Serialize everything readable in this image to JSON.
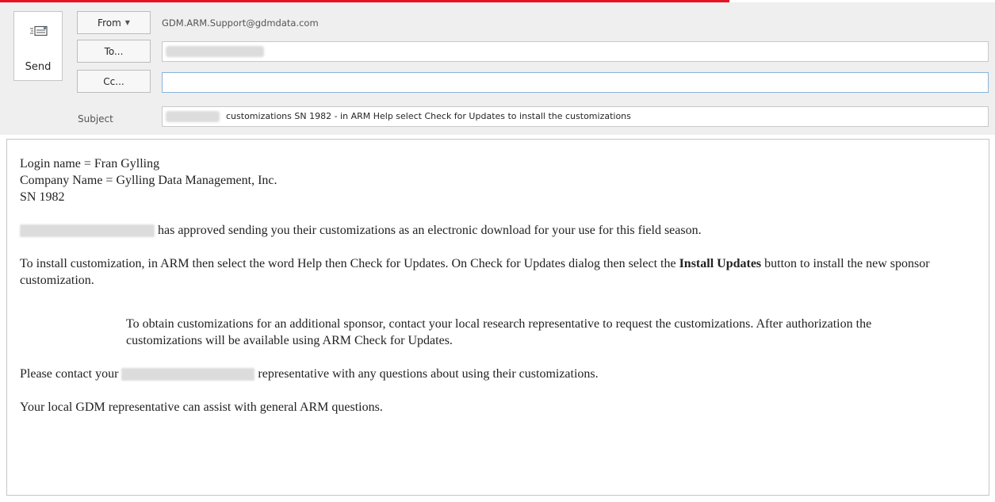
{
  "compose": {
    "send_label": "Send",
    "from_button": "From",
    "from_value": "GDM.ARM.Support@gdmdata.com",
    "to_button": "To...",
    "cc_button": "Cc...",
    "subject_label": "Subject",
    "subject_value": "customizations SN 1982 - in ARM Help select Check for Updates to install the customizations"
  },
  "message": {
    "line1": "Login name = Fran Gylling",
    "line2": "Company Name = Gylling Data Management, Inc.",
    "line3": "SN 1982",
    "para_approved": "has approved sending you their customizations as an electronic download for your use for this field season.",
    "para_install_a": "To install customization, in ARM then select the word Help then Check for Updates. On Check for Updates dialog then select the ",
    "para_install_bold": "Install Updates",
    "para_install_b": " button to install the new sponsor customization.",
    "para_indent": "To obtain customizations for an additional sponsor, contact your local research representative to request the customizations. After authorization the customizations will be available using ARM Check for Updates.",
    "para_contact_a": "Please contact your",
    "para_contact_b": "representative with any questions about using their customizations.",
    "para_local": "Your local GDM representative can assist with general ARM questions."
  }
}
